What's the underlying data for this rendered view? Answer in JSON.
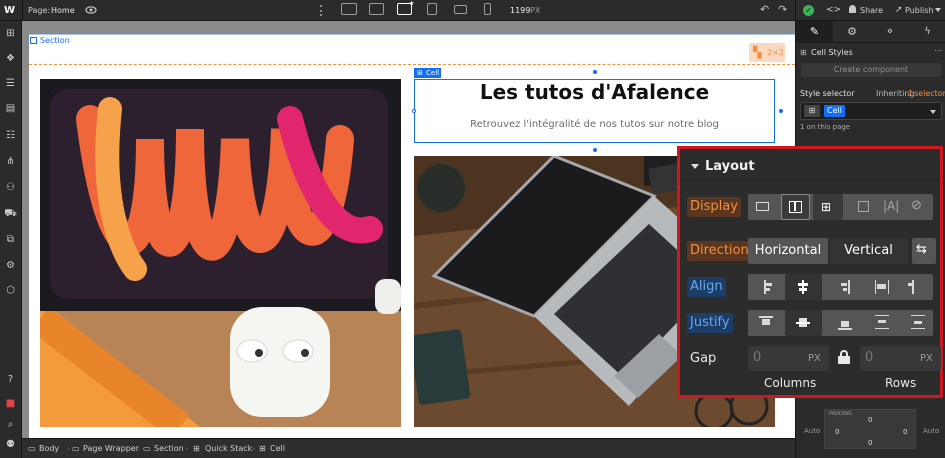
{
  "topbar": {
    "logo": "W",
    "page_label": "Page:",
    "page_name": "Home",
    "width_value": "1199",
    "width_unit": "PX",
    "share": "Share",
    "publish": "Publish"
  },
  "canvas": {
    "section_label": "Section",
    "cell_tag": "Cell",
    "grid_badge": "2×2",
    "heading": "Les tutos d'Afalence",
    "subheading": "Retrouvez l'intégralité de nos tutos sur notre blog"
  },
  "breadcrumbs": [
    "Body",
    "Page Wrapper",
    "Section",
    "Quick Stack",
    "Cell"
  ],
  "right_panel": {
    "cell_styles": "Cell Styles",
    "create_component": "Create component",
    "style_selector": "Style selector",
    "inheriting_prefix": "Inheriting",
    "inheriting_count": "1",
    "inheriting_suffix": "selector",
    "selector_chip": "Cell",
    "on_this_page": "1 on this page"
  },
  "layout_panel": {
    "title": "Layout",
    "display_label": "Display",
    "direction_label": "Direction",
    "direction_options": [
      "Horizontal",
      "Vertical"
    ],
    "align_label": "Align",
    "justify_label": "Justify",
    "gap_label": "Gap",
    "gap_col_value": "0",
    "gap_row_value": "0",
    "gap_unit": "PX",
    "columns_label": "Columns",
    "rows_label": "Rows"
  },
  "below_panel": {
    "margin_label": "MARGIN",
    "padding_label": "PADDING",
    "auto_left": "Auto",
    "auto_right": "Auto",
    "zero": "0"
  },
  "colors": {
    "accent_blue": "#146ef5",
    "accent_orange": "#f2913b",
    "panel_red_border": "#d0161e",
    "label_orange_bg": "#5a3520",
    "label_blue_bg": "#1c3d66"
  }
}
